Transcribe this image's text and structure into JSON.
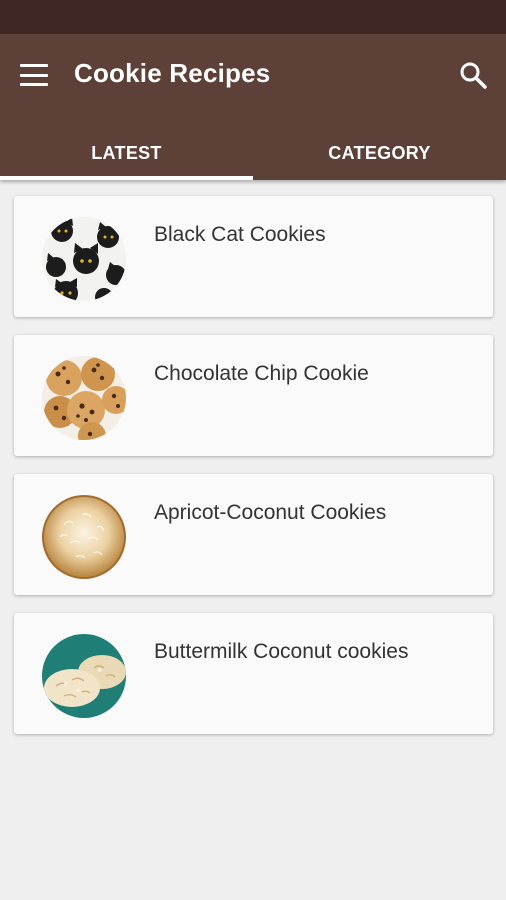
{
  "app": {
    "title": "Cookie Recipes"
  },
  "colors": {
    "status_bar": "#3e2723",
    "app_bar": "#5d4037",
    "background": "#efefef",
    "card": "#fafafa"
  },
  "icons": {
    "menu": "hamburger-menu-icon",
    "search": "search-icon"
  },
  "tabs": [
    {
      "label": "LATEST",
      "selected": true
    },
    {
      "label": "CATEGORY",
      "selected": false
    }
  ],
  "recipes": [
    {
      "title": "Black Cat Cookies",
      "image": "black-cat-cookies-thumbnail"
    },
    {
      "title": "Chocolate Chip Cookie",
      "image": "chocolate-chip-cookie-thumbnail"
    },
    {
      "title": "Apricot-Coconut Cookies",
      "image": "apricot-coconut-cookies-thumbnail"
    },
    {
      "title": "Buttermilk Coconut cookies",
      "image": "buttermilk-coconut-cookies-thumbnail"
    }
  ]
}
